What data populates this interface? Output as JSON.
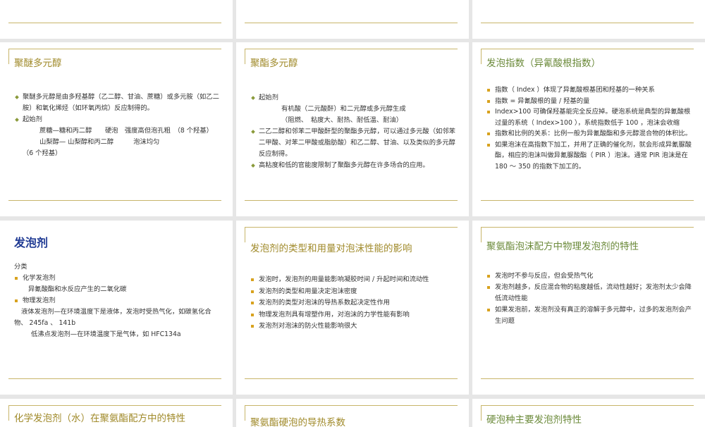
{
  "slides": {
    "s4": {
      "title": "聚醚多元醇",
      "items": [
        "聚醚多元醇是由多羟基醇（乙二醇、甘油、蔗糖）或多元胺（如乙二胺）和氧化烯烃（如环氧丙烷）反应制得的。",
        "起始剂"
      ],
      "lines": [
        "蔗糖—糖和丙二醇　　硬泡　强度高但泡孔粗　（8 个羟基）",
        "山梨醇— 山梨醇和丙二醇　　　泡沫均匀",
        "（6 个羟基）"
      ]
    },
    "s5": {
      "title": "聚酯多元醇",
      "item1": "起始剂",
      "sub1": "有机酸（二元酸酐）和二元醇或多元醇生成",
      "sub2": "（阻燃、　粘度大、耐热、耐低温、耐油）",
      "item2": "二乙二醇和邻苯二甲酸酐型的聚酯多元醇，可以通过多元酸（如邻苯二甲酸、对苯二甲酸或脂肪酸）和乙二醇、甘油、以及类似的多元醇反应制得。",
      "item3": "高粘度和低的官能度限制了聚酯多元醇在许多场合的应用。"
    },
    "s6": {
      "title": "发泡指数（异氰酸根指数）",
      "items": [
        "指数（ Index ）体现了异氰酸根基团和羟基的一种关系",
        "指数 = 异氰酸根的量 / 羟基的量",
        "Index>100 可确保羟基能完全反应掉。硬泡系统是典型的异氰酸根过量的系统（ Index>100 ），系统指数低于 100 ，泡沫会收缩",
        "指数和比例的关系：比例一般为异氰酸酯和多元醇混合物的体积比。",
        "如果泡沫在高指数下加工，并用了正确的催化剂，就会形成异氰脲酸酯，相应的泡沫叫做异氰脲酸酯（ PIR ）泡沫。通常 PIR 泡沫是在 180 ～ 350 的指数下加工的。"
      ]
    },
    "s7": {
      "title": "发泡剂",
      "label": "分类",
      "item1": "化学发泡剂",
      "sub1": "异氰酸酯和水反应产生的二氧化碳",
      "item2": "物理发泡剂",
      "sub2": "液体发泡剂—在环境温度下是液体，发泡时受热气化，如碳氢化合物、 245fa 、 141b",
      "sub3": "低沸点发泡剂—在环境温度下是气体，如 HFC134a"
    },
    "s8": {
      "title": "发泡剂的类型和用量对泡沫性能的影响",
      "items": [
        "发泡时，发泡剂的用量能影响凝胶时间 / 升起时间和流动性",
        "发泡剂的类型和用量决定泡沫密度",
        "发泡剂的类型对泡沫的导热系数起决定性作用",
        "物理发泡剂具有增塑作用，对泡沫的力学性能有影响",
        "发泡剂对泡沫的防火性能影响很大"
      ]
    },
    "s9": {
      "title": "聚氨酯泡沫配方中物理发泡剂的特性",
      "items": [
        "发泡时不参与反应，但会受热气化",
        "发泡剂越多，反应混合物的粘度越低，流动性越好；发泡剂太少会降低流动性能",
        "如果发泡前，发泡剂没有真正的溶解于多元醇中，过多的发泡剂会产生问题"
      ]
    },
    "s10": {
      "title": "化学发泡剂（水）在聚氨酯配方中的特性"
    },
    "s11": {
      "title": "聚氨酯硬泡的导热系数"
    },
    "s12": {
      "title": "硬泡种主要发泡剂特性"
    }
  },
  "colors": {
    "background": "#e6e6e6",
    "rule": "#c8b56a",
    "title_gold": "#a08a2a",
    "title_blue": "#1f3a93",
    "title_green": "#6b8a3a",
    "bullet_diamond": "#8a9a3a",
    "bullet_square": "#d8a21e"
  }
}
